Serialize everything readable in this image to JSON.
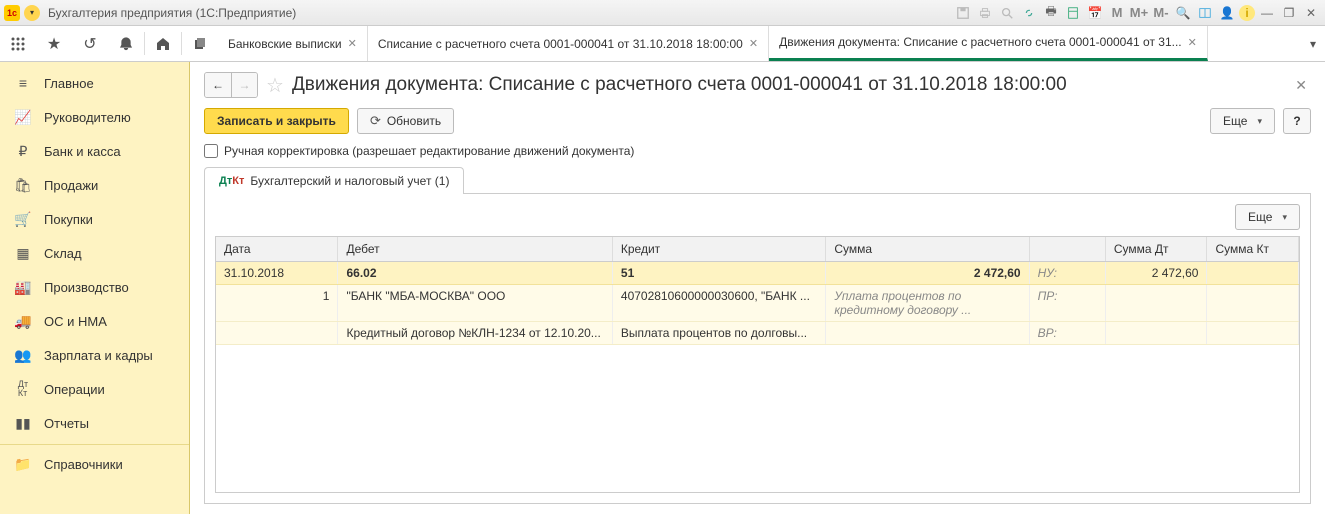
{
  "titlebar": {
    "app_title": "Бухгалтерия предприятия  (1С:Предприятие)",
    "m_labels": [
      "M",
      "M+",
      "M-"
    ]
  },
  "toolbar_tabs": {
    "tab1": {
      "label": "Банковские выписки"
    },
    "tab2": {
      "label": "Списание с расчетного счета 0001-000041 от 31.10.2018 18:00:00"
    },
    "tab3": {
      "label": "Движения документа: Списание с расчетного счета 0001-000041 от 31..."
    }
  },
  "sidebar": {
    "items": [
      {
        "label": "Главное"
      },
      {
        "label": "Руководителю"
      },
      {
        "label": "Банк и касса"
      },
      {
        "label": "Продажи"
      },
      {
        "label": "Покупки"
      },
      {
        "label": "Склад"
      },
      {
        "label": "Производство"
      },
      {
        "label": "ОС и НМА"
      },
      {
        "label": "Зарплата и кадры"
      },
      {
        "label": "Операции"
      },
      {
        "label": "Отчеты"
      },
      {
        "label": "Справочники"
      }
    ]
  },
  "page": {
    "title": "Движения документа: Списание с расчетного счета 0001-000041 от 31.10.2018 18:00:00",
    "save_close": "Записать и закрыть",
    "refresh": "Обновить",
    "more": "Еще",
    "help": "?",
    "manual_edit": "Ручная корректировка (разрешает редактирование движений документа)",
    "tab_label": "Бухгалтерский и налоговый учет (1)"
  },
  "grid": {
    "headers": {
      "date": "Дата",
      "debit": "Дебет",
      "credit": "Кредит",
      "sum": "Сумма",
      "sumdt": "Сумма Дт",
      "sumkt": "Сумма Кт"
    },
    "row1": {
      "date": "31.10.2018",
      "debit": "66.02",
      "credit": "51",
      "sum": "2 472,60",
      "tag": "НУ:",
      "sumdt": "2 472,60"
    },
    "row2": {
      "num": "1",
      "debit": "\"БАНК \"МБА-МОСКВА\" ООО",
      "credit": "40702810600000030600, \"БАНК ...",
      "sum": "Уплата процентов по кредитному договору ...",
      "tag": "ПР:"
    },
    "row3": {
      "debit": "Кредитный договор №КЛН-1234 от 12.10.20...",
      "credit": "Выплата процентов по долговы...",
      "tag": "ВР:"
    },
    "more": "Еще"
  }
}
